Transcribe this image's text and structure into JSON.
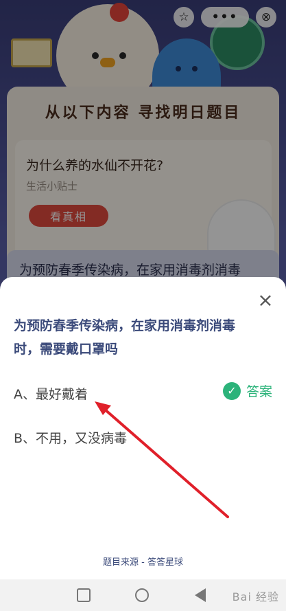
{
  "panel": {
    "title": "从以下内容 寻找明日题目"
  },
  "card": {
    "question": "为什么养的水仙不开花?",
    "subtitle": "生活小贴士",
    "button_label": "看真相"
  },
  "card2": {
    "text": "为预防春季传染病，在家用消毒剂消毒"
  },
  "topbar": {
    "star_icon": "☆",
    "more_icon": "•••",
    "close_icon": "⊗"
  },
  "sheet": {
    "close_icon": "×",
    "question": "为预防春季传染病，在家用消毒剂消毒时，需要戴口罩吗",
    "options": [
      {
        "label": "A、最好戴着",
        "is_answer": true
      },
      {
        "label": "B、不用，又没病毒",
        "is_answer": false
      }
    ],
    "answer_tag": "答案",
    "check_icon": "✓",
    "source": "题目来源 - 答答星球"
  },
  "navbar": {
    "watermark": "Bai 经验"
  },
  "colors": {
    "accent_green": "#2cb37a",
    "question_blue": "#3b4a7a",
    "arrow_red": "#e0202a"
  }
}
